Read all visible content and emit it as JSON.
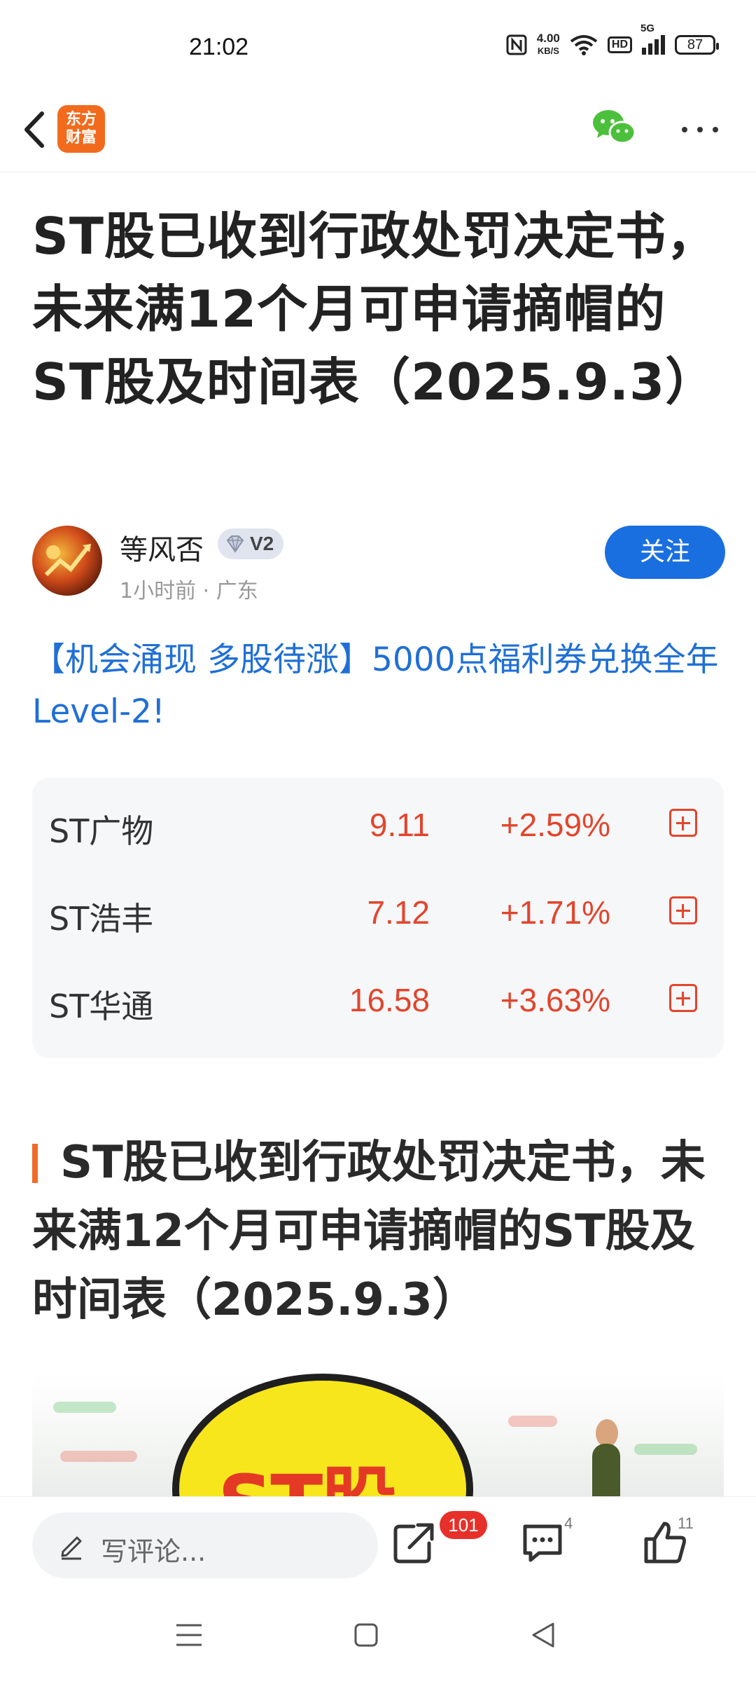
{
  "status_bar": {
    "time": "21:02",
    "net_speed_value": "4.00",
    "net_speed_unit": "KB/S",
    "hd_label": "HD",
    "network_label": "5G",
    "battery": "87"
  },
  "nav": {
    "logo_line1": "东方",
    "logo_line2": "财富",
    "icons": [
      "back-arrow-icon",
      "wechat-icon",
      "more-icon"
    ]
  },
  "article": {
    "title": "ST股已收到行政处罚决定书，未来满12个月可申请摘帽的ST股及时间表（2025.9.3）",
    "author": {
      "name": "等风否",
      "level": "V2",
      "meta": "1小时前 · 广东",
      "follow_label": "关注"
    },
    "promo": "【机会涌现 多股待涨】5000点福利券兑换全年Level-2!",
    "section_title": "ST股已收到行政处罚决定书，未来满12个月可申请摘帽的ST股及时间表（2025.9.3）",
    "image_text": "ST股"
  },
  "stocks": [
    {
      "name": "ST广物",
      "price": "9.11",
      "change": "+2.59%"
    },
    {
      "name": "ST浩丰",
      "price": "7.12",
      "change": "+1.71%"
    },
    {
      "name": "ST华通",
      "price": "16.58",
      "change": "+3.63%"
    }
  ],
  "bottom_bar": {
    "comment_placeholder": "写评论...",
    "share_count": "101",
    "comment_count": "4",
    "like_count": "11"
  },
  "colors": {
    "accent_blue": "#1a6fe0",
    "stock_red": "#e2452c",
    "brand_orange": "#f26b1d"
  }
}
